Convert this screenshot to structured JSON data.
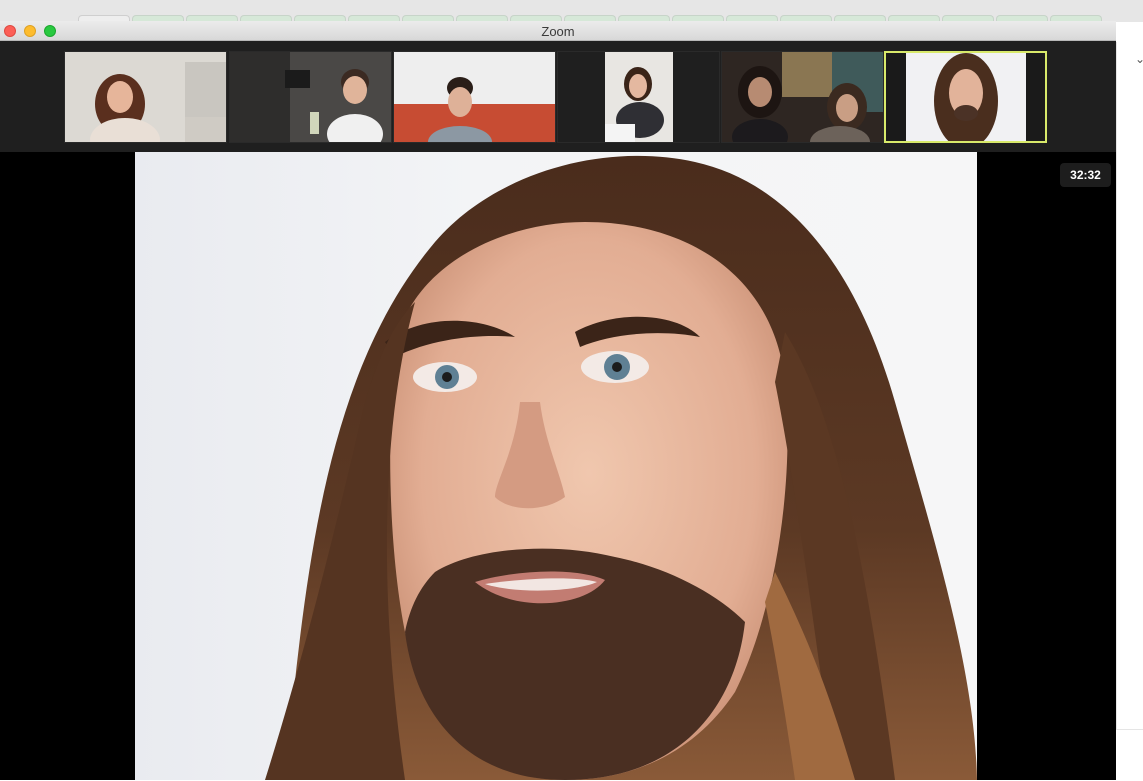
{
  "window": {
    "title": "Zoom"
  },
  "thumbnails": [
    {
      "id": 1,
      "active_speaker": false
    },
    {
      "id": 2,
      "active_speaker": false
    },
    {
      "id": 3,
      "active_speaker": false
    },
    {
      "id": 4,
      "active_speaker": false
    },
    {
      "id": 5,
      "active_speaker": false
    },
    {
      "id": 6,
      "active_speaker": true
    }
  ],
  "main_video": {
    "timer": "32:32"
  },
  "side_panel": {
    "chevron_icon": "chevron-down-icon"
  },
  "colors": {
    "active_speaker_border": "#d8e96a",
    "strip_background": "#1f1f1f",
    "timer_background": "#1d1d1d"
  }
}
